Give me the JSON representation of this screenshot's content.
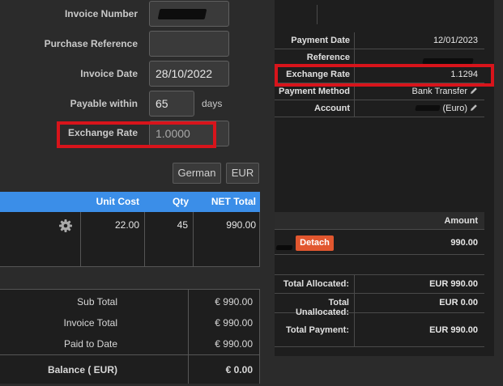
{
  "invoice_form": {
    "invoice_number_label": "Invoice Number",
    "purchase_reference_label": "Purchase Reference",
    "purchase_reference_value": "",
    "invoice_date_label": "Invoice Date",
    "invoice_date_value": "28/10/2022",
    "payable_within_label": "Payable within",
    "payable_within_value": "65",
    "payable_within_unit": "days",
    "exchange_rate_label": "Exchange Rate",
    "exchange_rate_value": "1.0000",
    "language_button": "German",
    "currency_button": "EUR"
  },
  "items_table": {
    "columns": [
      "Unit Cost",
      "Qty",
      "NET Total"
    ],
    "rows": [
      {
        "unit_cost": "22.00",
        "qty": "45",
        "net_total": "990.00"
      }
    ]
  },
  "totals": {
    "sub_total_label": "Sub Total",
    "sub_total_value": "€ 990.00",
    "invoice_total_label": "Invoice Total",
    "invoice_total_value": "€ 990.00",
    "paid_to_date_label": "Paid to Date",
    "paid_to_date_value": "€ 990.00",
    "balance_label": "Balance ( EUR)",
    "balance_value": "€ 0.00"
  },
  "payment_details": {
    "payment_date_label": "Payment Date",
    "payment_date_value": "12/01/2023",
    "reference_label": "Reference",
    "exchange_rate_label": "Exchange Rate",
    "exchange_rate_value": "1.1294",
    "payment_method_label": "Payment Method",
    "payment_method_value": "Bank Transfer",
    "account_label": "Account",
    "account_value": "(Euro)"
  },
  "allocations": {
    "amount_header": "Amount",
    "detach_button": "Detach",
    "row_amount": "990.00",
    "total_allocated_label": "Total Allocated:",
    "total_allocated_value": "EUR 990.00",
    "total_unallocated_label": "Total Unallocated:",
    "total_unallocated_value": "EUR 0.00",
    "total_payment_label": "Total Payment:",
    "total_payment_value": "EUR 990.00"
  },
  "colors": {
    "highlight_red": "#d8141b",
    "table_header_blue": "#3b8ee8",
    "detach_orange": "#e2572f"
  }
}
